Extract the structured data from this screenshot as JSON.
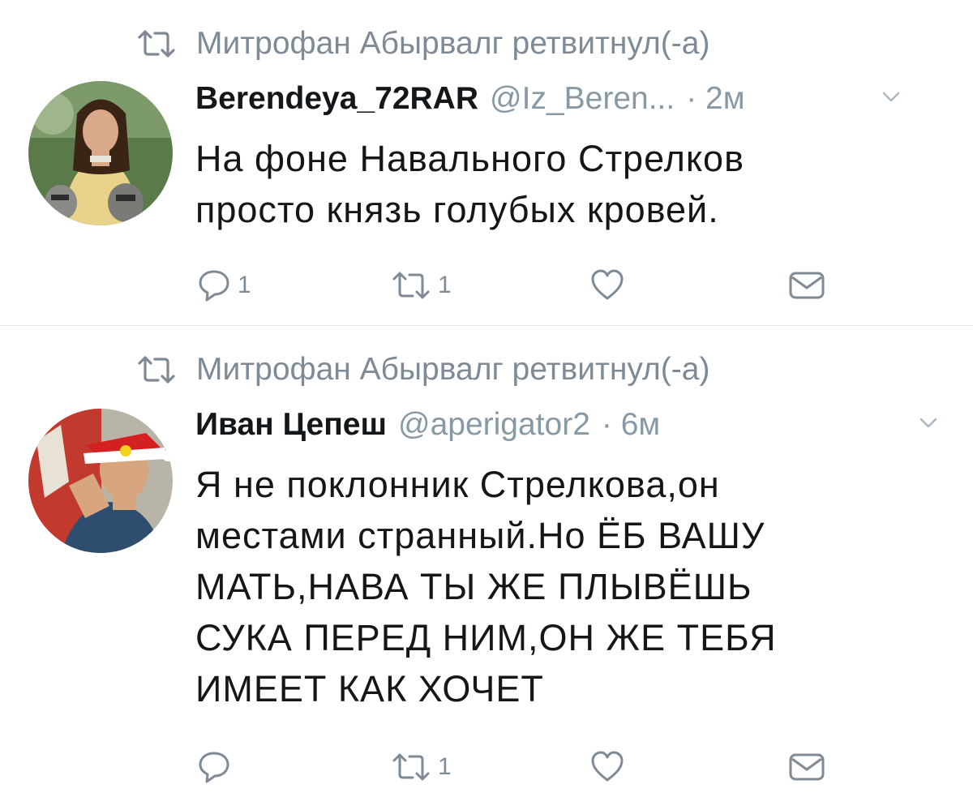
{
  "tweets": [
    {
      "retweet_label": "Митрофан Абырвалг ретвитнул(-а)",
      "name": "Berendeya_72RAR",
      "handle": "@Iz_Beren...",
      "time": "· 2м",
      "text": [
        "На фоне Навального Стрелков",
        "просто князь голубых кровей."
      ],
      "actions": {
        "reply_count": "1",
        "retweet_count": "1",
        "like_count": ""
      }
    },
    {
      "retweet_label": "Митрофан Абырвалг ретвитнул(-а)",
      "name": "Иван Цепеш",
      "handle": "@aperigator2",
      "time": "· 6м",
      "text": [
        "Я не поклонник Стрелкова,он",
        "местами странный.Но ЁБ ВАШУ",
        "МАТЬ,НАВА ТЫ ЖЕ ПЛЫВЁШЬ",
        "СУКА ПЕРЕД НИМ,ОН ЖЕ ТЕБЯ",
        "ИМЕЕТ КАК ХОЧЕТ"
      ],
      "actions": {
        "reply_count": "",
        "retweet_count": "1",
        "like_count": ""
      }
    }
  ],
  "colors": {
    "secondary": "#7e8b96",
    "primary_text": "#14171a",
    "divider": "#e1e8ed"
  }
}
